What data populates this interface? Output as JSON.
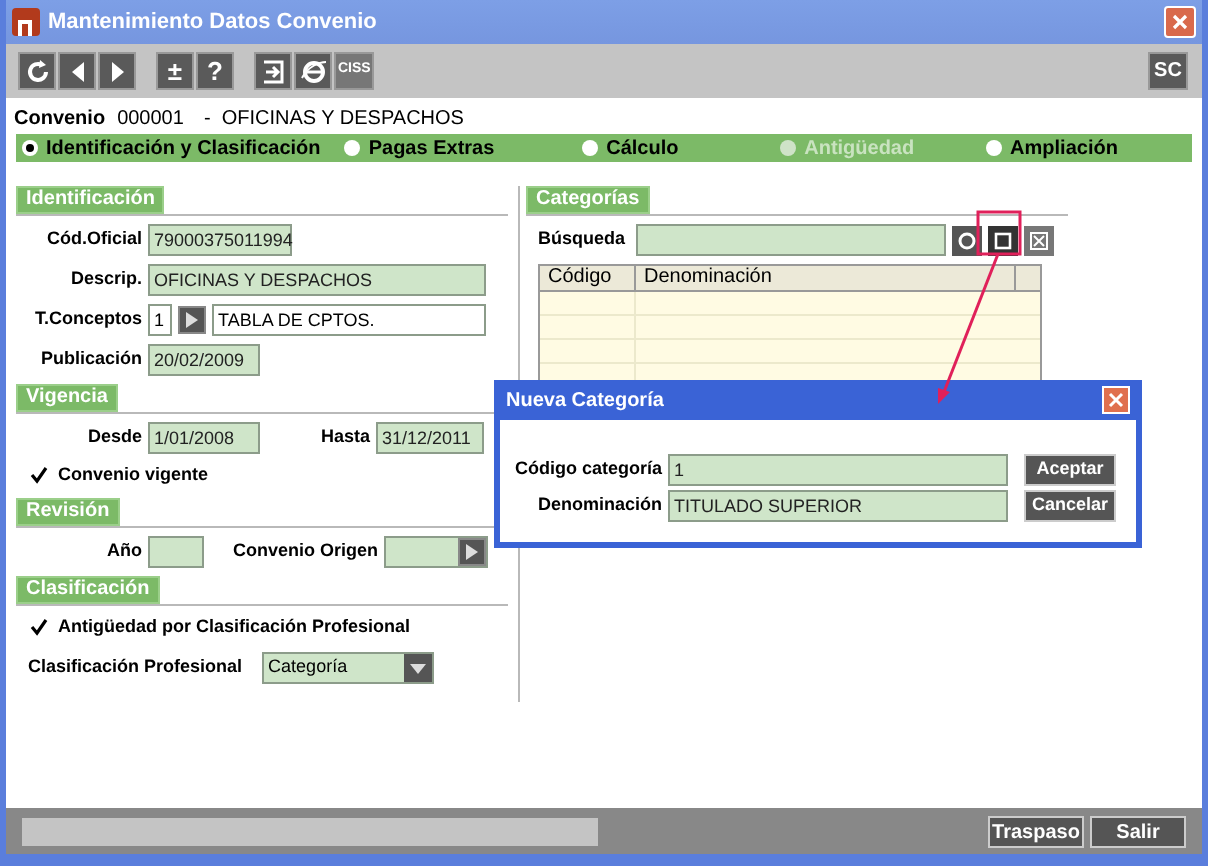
{
  "window": {
    "title": "Mantenimiento Datos Convenio"
  },
  "toolbar": {
    "buttons": [
      {
        "kind": "refresh"
      },
      {
        "kind": "prev"
      },
      {
        "kind": "next"
      },
      {
        "kind": "text",
        "label": "±"
      },
      {
        "kind": "text",
        "label": "?"
      },
      {
        "kind": "exit"
      },
      {
        "kind": "browser"
      },
      {
        "kind": "text",
        "label": "CISS"
      }
    ],
    "right_button": {
      "label": "SC"
    }
  },
  "convenio": {
    "label": "Convenio",
    "code": "000001",
    "name": "-  OFICINAS Y DESPACHOS"
  },
  "sections": [
    {
      "label": "Identificación y Clasificación",
      "selected": true,
      "disabled": false
    },
    {
      "label": "Pagas Extras",
      "selected": false,
      "disabled": false
    },
    {
      "label": "Cálculo",
      "selected": false,
      "disabled": false
    },
    {
      "label": "Antigüedad",
      "selected": false,
      "disabled": true
    },
    {
      "label": "Ampliación",
      "selected": false,
      "disabled": false
    }
  ],
  "identificacion": {
    "title": "Identificación",
    "cod_oficial": {
      "label": "Cód.Oficial",
      "value": "79000375011994"
    },
    "descrip": {
      "label": "Descrip.",
      "value": "OFICINAS Y DESPACHOS"
    },
    "t_conceptos": {
      "label": "T.Conceptos",
      "code": "1",
      "value": "TABLA DE CPTOS."
    },
    "publicacion": {
      "label": "Publicación",
      "value": "20/02/2009"
    }
  },
  "vigencia": {
    "title": "Vigencia",
    "desde": {
      "label": "Desde",
      "value": "1/01/2008"
    },
    "hasta": {
      "label": "Hasta",
      "value": "31/12/2011"
    },
    "vigente": {
      "label": "Convenio vigente",
      "checked": true
    }
  },
  "revision": {
    "title": "Revisión",
    "anio": {
      "label": "Año"
    },
    "origen": {
      "label": "Convenio Origen"
    }
  },
  "clasificacion": {
    "title": "Clasificación",
    "antiguedad": {
      "label": "Antigüedad por Clasificación Profesional",
      "checked": true
    },
    "profesional": {
      "label": "Clasificación Profesional",
      "value": "Categoría"
    }
  },
  "categorias": {
    "title": "Categorías",
    "search": {
      "label": "Búsqueda"
    },
    "columns": [
      "Código",
      "Denominación"
    ]
  },
  "dialog": {
    "title": "Nueva Categoría",
    "fields": [
      {
        "label": "Código categoría",
        "value": "1"
      },
      {
        "label": "Denominación",
        "value": "TITULADO SUPERIOR"
      }
    ],
    "buttons": [
      "Aceptar",
      "Cancelar"
    ]
  },
  "status_bar": {
    "progress": {
      "level": 0
    },
    "buttons": [
      "Traspaso",
      "Salir"
    ]
  }
}
